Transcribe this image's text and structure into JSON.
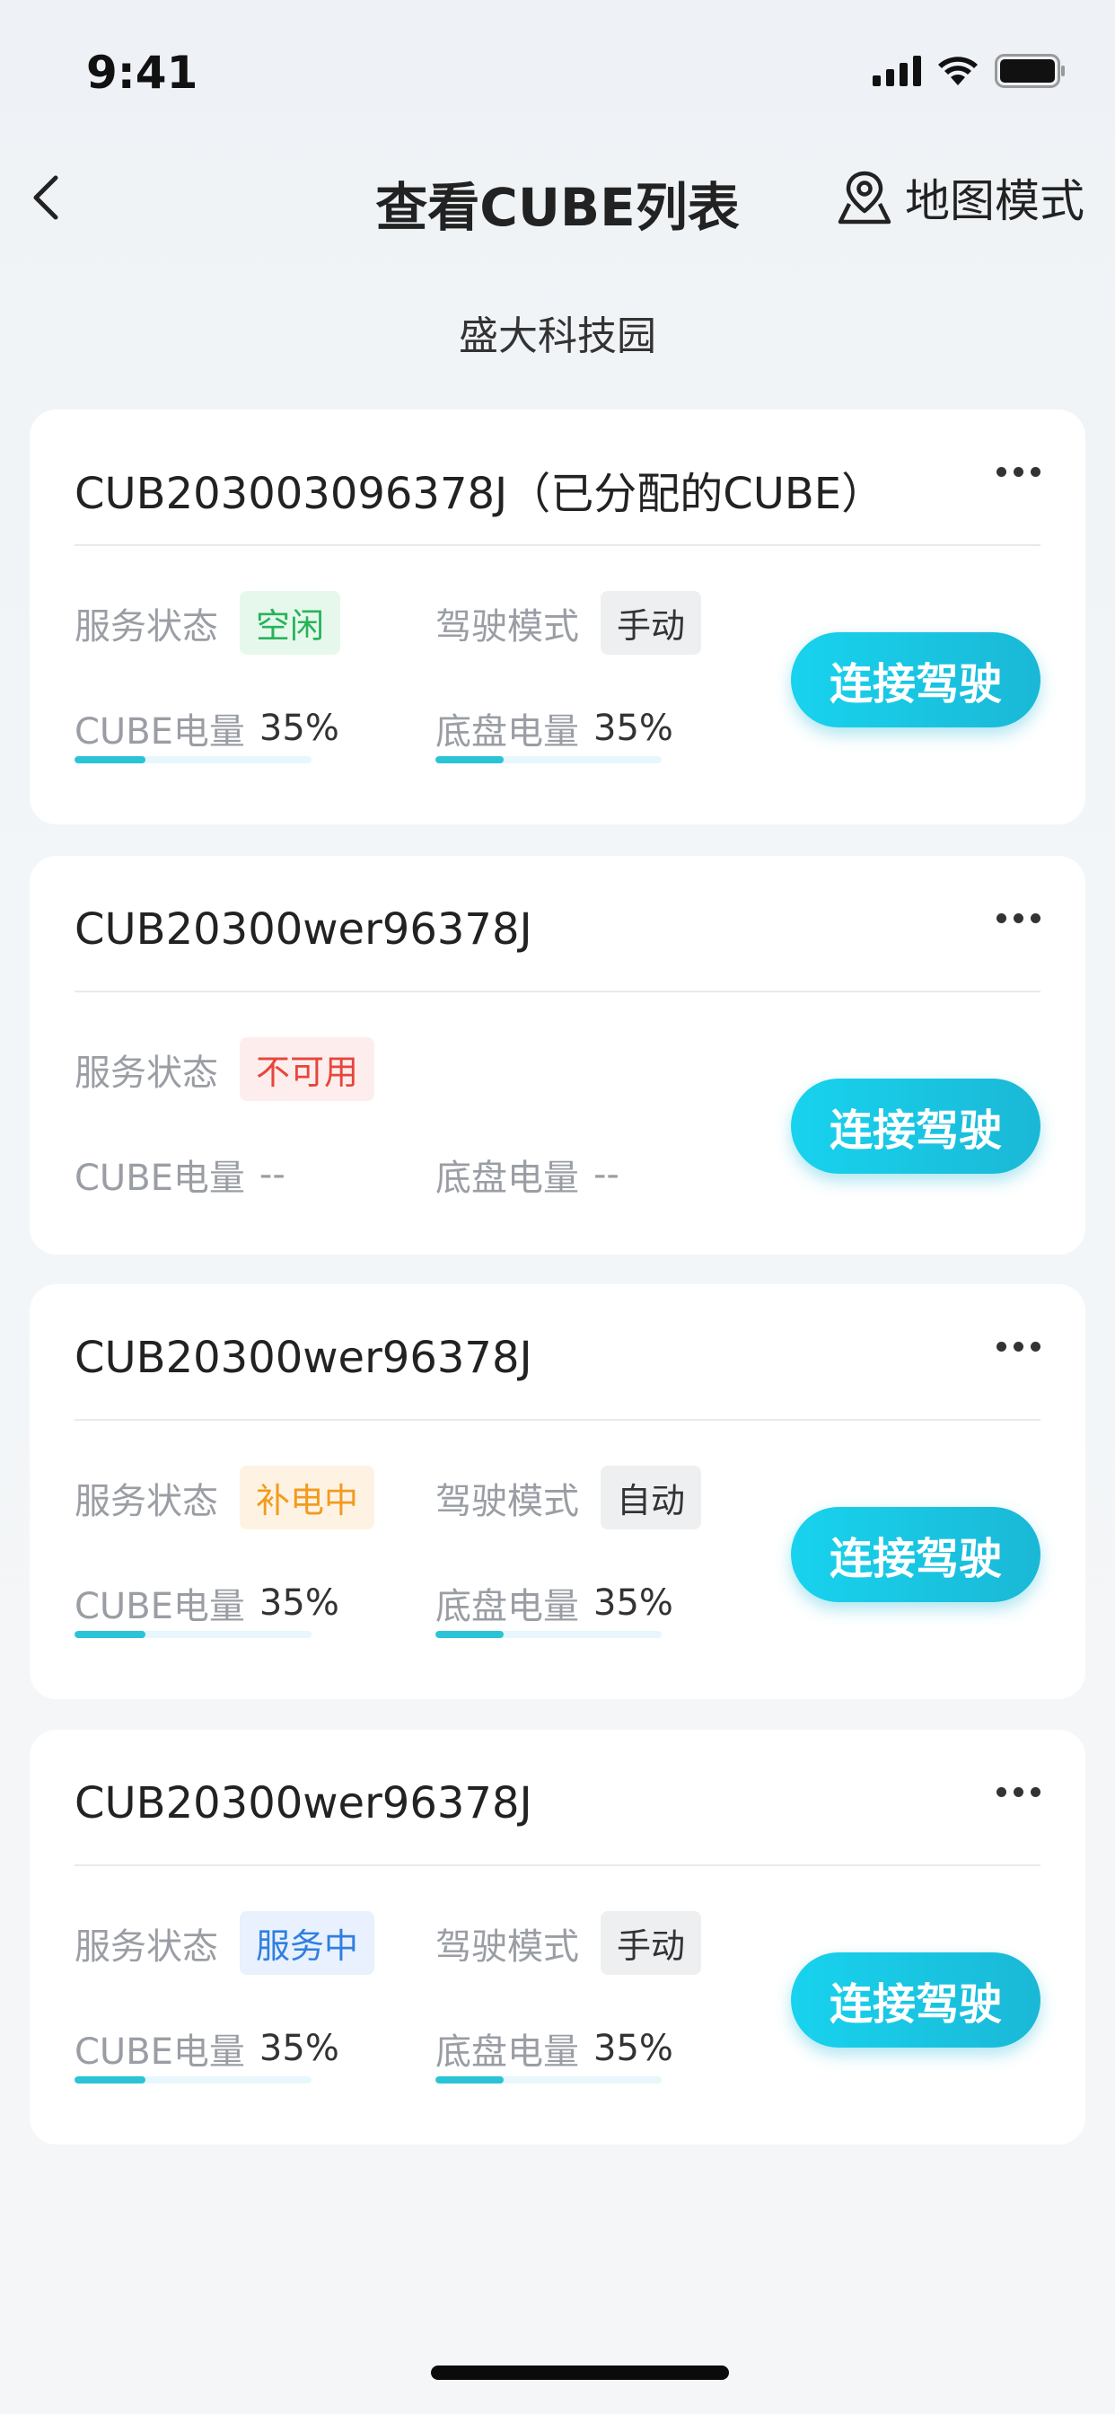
{
  "status_bar": {
    "time": "9:41"
  },
  "nav": {
    "title": "查看CUBE列表",
    "map_mode": "地图模式"
  },
  "location": "盛大科技园",
  "labels": {
    "service_status": "服务状态",
    "drive_mode": "驾驶模式",
    "cube_battery": "CUBE电量",
    "chassis_battery": "底盘电量",
    "connect_button": "连接驾驶"
  },
  "cards": [
    {
      "title": "CUB203003096378J（已分配的CUBE）",
      "status": "空闲",
      "status_color": "#27b35a",
      "status_bg": "#e6f8ec",
      "drive_mode": "手动",
      "cube_battery": "35%",
      "cube_battery_level": 0.3,
      "chassis_battery": "35%",
      "chassis_battery_level": 0.3
    },
    {
      "title": "CUB20300wer96378J",
      "status": "不可用",
      "status_color": "#e8453c",
      "status_bg": "#fdeeed",
      "drive_mode": null,
      "cube_battery": "--",
      "chassis_battery": "--"
    },
    {
      "title": "CUB20300wer96378J",
      "status": "补电中",
      "status_color": "#f29b1f",
      "status_bg": "#fef3e3",
      "drive_mode": "自动",
      "cube_battery": "35%",
      "cube_battery_level": 0.3,
      "chassis_battery": "35%",
      "chassis_battery_level": 0.3
    },
    {
      "title": "CUB20300wer96378J",
      "status": "服务中",
      "status_color": "#2f7fe0",
      "status_bg": "#e8f1fd",
      "drive_mode": "手动",
      "cube_battery": "35%",
      "cube_battery_level": 0.3,
      "chassis_battery": "35%",
      "chassis_battery_level": 0.3
    }
  ],
  "colors": {
    "accent": "#1ac8e2",
    "mode_badge_bg": "#eeeff1"
  },
  "icons": {
    "back": "chevron-left-icon",
    "map": "map-pin-icon",
    "more": "more-dots-icon"
  }
}
